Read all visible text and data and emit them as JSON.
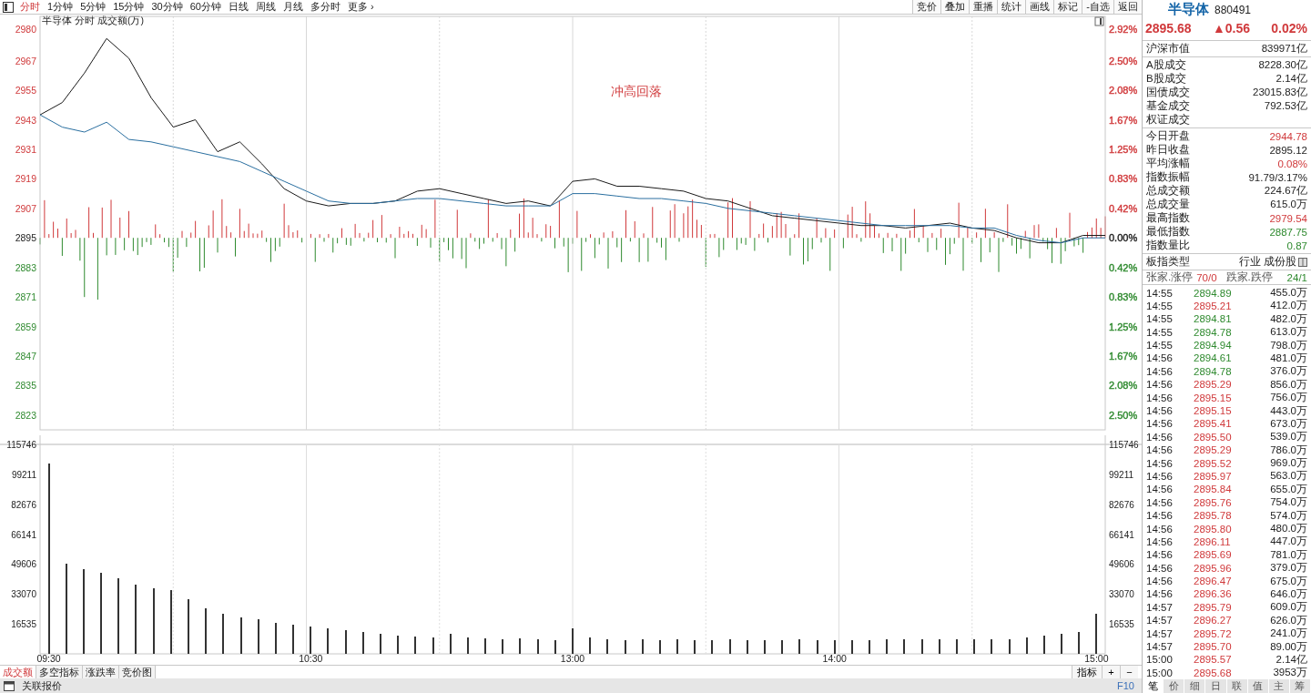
{
  "toolbar": {
    "period_tabs": [
      {
        "label": "分时",
        "selected": true
      },
      {
        "label": "1分钟",
        "selected": false
      },
      {
        "label": "5分钟",
        "selected": false
      },
      {
        "label": "15分钟",
        "selected": false
      },
      {
        "label": "30分钟",
        "selected": false
      },
      {
        "label": "60分钟",
        "selected": false
      },
      {
        "label": "日线",
        "selected": false
      },
      {
        "label": "周线",
        "selected": false
      },
      {
        "label": "月线",
        "selected": false
      },
      {
        "label": "多分时",
        "selected": false
      },
      {
        "label": "更多 ›",
        "selected": false
      }
    ],
    "tools": [
      "竞价",
      "叠加",
      "重播",
      "统计",
      "画线",
      "标记",
      "-自选",
      "返回"
    ]
  },
  "price_panel": {
    "title": "半导体",
    "subtitle": "分时 成交额(万)",
    "percent_labels": [
      {
        "text": "2.92%",
        "color": "#d0393b"
      },
      {
        "text": "2.50%",
        "color": "#d0393b"
      },
      {
        "text": "2.08%",
        "color": "#d0393b"
      },
      {
        "text": "1.67%",
        "color": "#d0393b"
      },
      {
        "text": "1.25%",
        "color": "#d0393b"
      },
      {
        "text": "0.83%",
        "color": "#d0393b"
      },
      {
        "text": "0.42%",
        "color": "#d0393b"
      },
      {
        "text": "0.00%",
        "color": "#222222"
      },
      {
        "text": "0.42%",
        "color": "#2f8a2f"
      },
      {
        "text": "0.83%",
        "color": "#2f8a2f"
      },
      {
        "text": "1.25%",
        "color": "#2f8a2f"
      },
      {
        "text": "1.67%",
        "color": "#2f8a2f"
      },
      {
        "text": "2.08%",
        "color": "#2f8a2f"
      },
      {
        "text": "2.50%",
        "color": "#2f8a2f"
      }
    ],
    "chart_data": {
      "type": "line",
      "categories": [
        null,
        null,
        null,
        null,
        null,
        null,
        null,
        null,
        null,
        null,
        null,
        null,
        null,
        null,
        null,
        null,
        null,
        null,
        null,
        null,
        null,
        null,
        null,
        null,
        null,
        null,
        null,
        null,
        null,
        null,
        null,
        null,
        null,
        null,
        null,
        null,
        null,
        null,
        null,
        null,
        null,
        null,
        null,
        null,
        null,
        null,
        null,
        null,
        null
      ],
      "series": [
        {
          "color": "#1a1a1a",
          "values": [
            2945,
            2950,
            2962,
            2976,
            2968,
            2952,
            2940,
            2943,
            2930,
            2934,
            2925,
            2915,
            2910,
            2908,
            2909,
            2909,
            2910,
            2914,
            2915,
            2913,
            2911,
            2909,
            2910,
            2908,
            2918,
            2919,
            2916,
            2916,
            2915,
            2914,
            2911,
            2910,
            2907,
            2904,
            2903,
            2902,
            2901,
            2900,
            2900,
            2899,
            2900,
            2901,
            2899,
            2898,
            2895,
            2893,
            2893,
            2896,
            2896
          ]
        },
        {
          "color": "#2a6fa0",
          "values": [
            2945,
            2940,
            2938,
            2942,
            2935,
            2934,
            2932,
            2930,
            2928,
            2926,
            2922,
            2918,
            2914,
            2910,
            2909,
            2909,
            2910,
            2911,
            2911,
            2910,
            2909,
            2908,
            2908,
            2908,
            2913,
            2913,
            2912,
            2911,
            2911,
            2910,
            2909,
            2907,
            2906,
            2905,
            2904,
            2903,
            2902,
            2901,
            2900,
            2900,
            2900,
            2900,
            2899,
            2899,
            2896,
            2894,
            2893,
            2895,
            2895
          ]
        }
      ],
      "ylim": [
        2817,
        2985
      ],
      "yticks": [
        2980,
        2967,
        2955,
        2943,
        2931,
        2919,
        2907,
        2895,
        2883,
        2871,
        2859,
        2847,
        2835,
        2823
      ],
      "grid": true,
      "annotations": [
        "冲高回落"
      ]
    }
  },
  "volume_panel": {
    "chart_data": {
      "type": "bar",
      "categories": [
        "09:30",
        null,
        null,
        null,
        null,
        null,
        null,
        null,
        null,
        null,
        null,
        null,
        null,
        null,
        null,
        "10:30",
        null,
        null,
        null,
        null,
        null,
        null,
        null,
        null,
        null,
        null,
        null,
        null,
        null,
        null,
        "13:00",
        null,
        null,
        null,
        null,
        null,
        null,
        null,
        null,
        null,
        null,
        null,
        null,
        null,
        null,
        "14:00",
        null,
        null,
        null,
        null,
        null,
        null,
        null,
        null,
        null,
        null,
        null,
        null,
        null,
        null,
        "15:00"
      ],
      "values": [
        105000,
        50000,
        47000,
        45000,
        42000,
        38000,
        36000,
        35000,
        30000,
        25000,
        22000,
        20000,
        19000,
        17000,
        16000,
        15000,
        14000,
        13000,
        12000,
        11000,
        10000,
        9500,
        9000,
        11000,
        9000,
        8500,
        8000,
        8500,
        8000,
        7500,
        14000,
        9000,
        8000,
        7500,
        8000,
        7500,
        8000,
        7500,
        7600,
        8000,
        7600,
        7500,
        7600,
        8000,
        7500,
        7600,
        7500,
        7600,
        8000,
        8000,
        8000,
        8000,
        8000,
        8000,
        8000,
        8000,
        9000,
        10000,
        11000,
        12000,
        22000
      ],
      "ylim": [
        0,
        120778
      ],
      "yticks": [
        115746,
        99211,
        82676,
        66141,
        49606,
        33070,
        16535
      ],
      "grid": true
    },
    "left_labels": [
      "115746",
      "99211",
      "82676",
      "66141",
      "49606",
      "33070",
      "16535"
    ],
    "right_labels": [
      "115746",
      "99211",
      "82676",
      "66141",
      "49606",
      "33070",
      "16535"
    ]
  },
  "indicator_tabs": [
    {
      "label": "成交额",
      "selected": true
    },
    {
      "label": "多空指标",
      "selected": false
    },
    {
      "label": "涨跌率",
      "selected": false
    },
    {
      "label": "竞价图",
      "selected": false
    }
  ],
  "indicator_buttons": [
    "指标",
    "+",
    "−"
  ],
  "status_bar": {
    "label": "关联报价",
    "shortcut": "F10"
  },
  "quote": {
    "name": "半导体",
    "code": "880491",
    "price": "2895.68",
    "change": "▲0.56",
    "change_pct": "0.02%"
  },
  "stats": [
    [
      {
        "label": "沪深市值",
        "value": "839971亿"
      }
    ],
    [
      {
        "label": "A股成交",
        "value": "8228.30亿"
      },
      {
        "label": "B股成交",
        "value": "2.14亿"
      },
      {
        "label": "国债成交",
        "value": "23015.83亿"
      },
      {
        "label": "基金成交",
        "value": "792.53亿"
      },
      {
        "label": "权证成交"
      }
    ],
    [
      {
        "label": "今日开盘",
        "value": "2944.78",
        "color": "#d0393b"
      },
      {
        "label": "昨日收盘",
        "value": "2895.12"
      },
      {
        "label": "平均涨幅",
        "value": "0.08%",
        "color": "#d0393b"
      },
      {
        "label": "指数振幅",
        "value": "91.79/3.17%"
      },
      {
        "label": "总成交额",
        "value": "224.67亿"
      },
      {
        "label": "总成交量",
        "value": "615.0万"
      },
      {
        "label": "最高指数",
        "value": "2979.54",
        "color": "#d0393b"
      },
      {
        "label": "最低指数",
        "value": "2887.75",
        "color": "#2f8a2f"
      },
      {
        "label": "指数量比",
        "value": "0.87",
        "color": "#2f8a2f"
      }
    ],
    [
      {
        "label": "板指类型",
        "value": "行业 成份股"
      }
    ]
  ],
  "breadth": {
    "up_label": "张家.涨停",
    "up_value": "70/0",
    "down_label": "跌家.跌停",
    "down_value": "24/1"
  },
  "ticks": [
    {
      "time": "14:55",
      "price": "2894.89",
      "volume": "455.0万",
      "color": "#2f8a2f"
    },
    {
      "time": "14:55",
      "price": "2895.21",
      "volume": "412.0万",
      "color": "#d0393b"
    },
    {
      "time": "14:55",
      "price": "2894.81",
      "volume": "482.0万",
      "color": "#2f8a2f"
    },
    {
      "time": "14:55",
      "price": "2894.78",
      "volume": "613.0万",
      "color": "#2f8a2f"
    },
    {
      "time": "14:55",
      "price": "2894.94",
      "volume": "798.0万",
      "color": "#2f8a2f"
    },
    {
      "time": "14:56",
      "price": "2894.61",
      "volume": "481.0万",
      "color": "#2f8a2f"
    },
    {
      "time": "14:56",
      "price": "2894.78",
      "volume": "376.0万",
      "color": "#2f8a2f"
    },
    {
      "time": "14:56",
      "price": "2895.29",
      "volume": "856.0万",
      "color": "#d0393b"
    },
    {
      "time": "14:56",
      "price": "2895.15",
      "volume": "756.0万",
      "color": "#d0393b"
    },
    {
      "time": "14:56",
      "price": "2895.15",
      "volume": "443.0万",
      "color": "#d0393b"
    },
    {
      "time": "14:56",
      "price": "2895.41",
      "volume": "673.0万",
      "color": "#d0393b"
    },
    {
      "time": "14:56",
      "price": "2895.50",
      "volume": "539.0万",
      "color": "#d0393b"
    },
    {
      "time": "14:56",
      "price": "2895.29",
      "volume": "786.0万",
      "color": "#d0393b"
    },
    {
      "time": "14:56",
      "price": "2895.52",
      "volume": "969.0万",
      "color": "#d0393b"
    },
    {
      "time": "14:56",
      "price": "2895.97",
      "volume": "563.0万",
      "color": "#d0393b"
    },
    {
      "time": "14:56",
      "price": "2895.84",
      "volume": "655.0万",
      "color": "#d0393b"
    },
    {
      "time": "14:56",
      "price": "2895.76",
      "volume": "754.0万",
      "color": "#d0393b"
    },
    {
      "time": "14:56",
      "price": "2895.78",
      "volume": "574.0万",
      "color": "#d0393b"
    },
    {
      "time": "14:56",
      "price": "2895.80",
      "volume": "480.0万",
      "color": "#d0393b"
    },
    {
      "time": "14:56",
      "price": "2896.11",
      "volume": "447.0万",
      "color": "#d0393b"
    },
    {
      "time": "14:56",
      "price": "2895.69",
      "volume": "781.0万",
      "color": "#d0393b"
    },
    {
      "time": "14:56",
      "price": "2895.96",
      "volume": "379.0万",
      "color": "#d0393b"
    },
    {
      "time": "14:56",
      "price": "2896.47",
      "volume": "675.0万",
      "color": "#d0393b"
    },
    {
      "time": "14:56",
      "price": "2896.36",
      "volume": "646.0万",
      "color": "#d0393b"
    },
    {
      "time": "14:57",
      "price": "2895.79",
      "volume": "609.0万",
      "color": "#d0393b"
    },
    {
      "time": "14:57",
      "price": "2896.27",
      "volume": "626.0万",
      "color": "#d0393b"
    },
    {
      "time": "14:57",
      "price": "2895.72",
      "volume": "241.0万",
      "color": "#d0393b"
    },
    {
      "time": "14:57",
      "price": "2895.70",
      "volume": "89.00万",
      "color": "#d0393b"
    },
    {
      "time": "15:00",
      "price": "2895.57",
      "volume": "2.14亿",
      "color": "#d0393b"
    },
    {
      "time": "15:00",
      "price": "2895.68",
      "volume": "3953万",
      "color": "#d0393b"
    }
  ],
  "panel_tabs": [
    {
      "label": "笔",
      "selected": true
    },
    {
      "label": "价",
      "selected": false
    },
    {
      "label": "细",
      "selected": false
    },
    {
      "label": "日",
      "selected": false
    },
    {
      "label": "联",
      "selected": false
    },
    {
      "label": "值",
      "selected": false
    },
    {
      "label": "主",
      "selected": false
    },
    {
      "label": "筹",
      "selected": false
    }
  ]
}
